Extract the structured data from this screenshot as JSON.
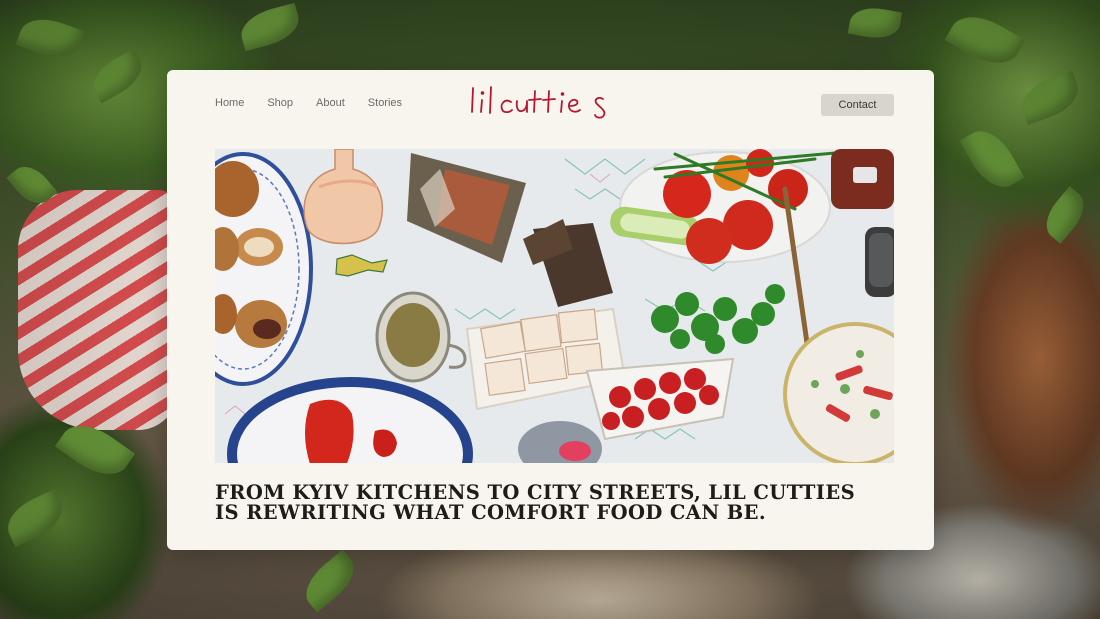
{
  "nav": {
    "items": [
      {
        "label": "Home"
      },
      {
        "label": "Shop"
      },
      {
        "label": "About"
      },
      {
        "label": "Stories"
      }
    ]
  },
  "brand": {
    "logo_text": "lil cutties",
    "logo_color": "#b3182e"
  },
  "header": {
    "contact_label": "Contact"
  },
  "hero": {
    "icon": "food-table-photo"
  },
  "headline": {
    "line1": "FROM KYIV KITCHENS TO CITY STREETS, LIL CUTTIES",
    "line2": "IS REWRITING WHAT COMFORT FOOD CAN BE."
  },
  "colors": {
    "card_background": "#f8f4ee",
    "contact_button": "#d8d5cc",
    "text_dark": "#1e1c19",
    "nav_text": "#6d6b66"
  }
}
